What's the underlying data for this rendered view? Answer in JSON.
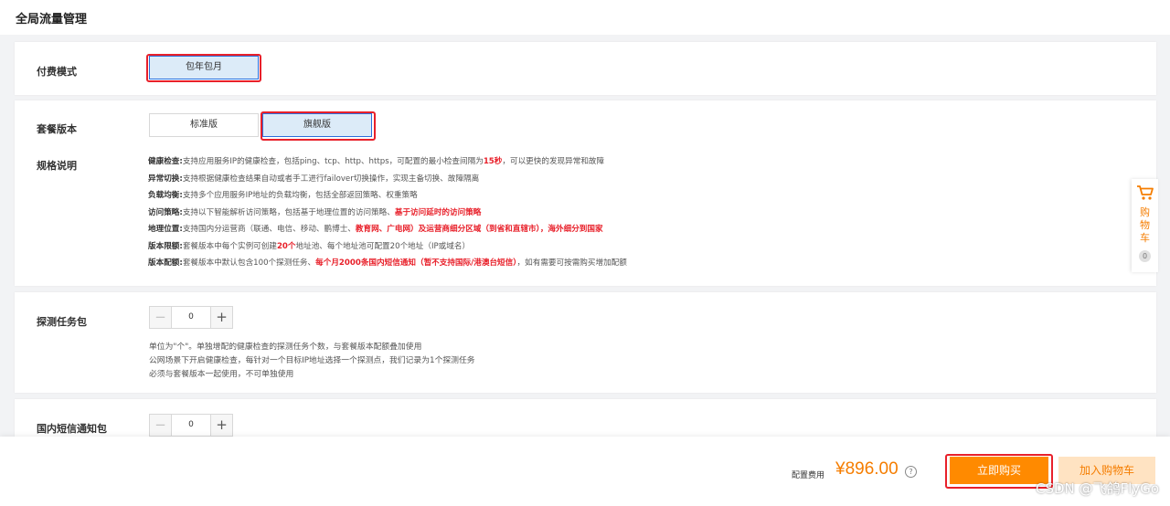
{
  "page": {
    "title": "全局流量管理"
  },
  "billing": {
    "label": "付费模式",
    "option": "包年包月"
  },
  "edition": {
    "label": "套餐版本",
    "options": [
      "标准版",
      "旗舰版"
    ],
    "selected": "旗舰版"
  },
  "spec": {
    "label": "规格说明",
    "lines": [
      {
        "key": "健康检查:",
        "text": "支持应用服务IP的健康检查，包括ping、tcp、http、https，可配置的最小检查间隔为",
        "red": "15秒",
        "tail": "，可以更快的发现异常和故障"
      },
      {
        "key": "异常切换:",
        "text": "支持根据健康检查结果自动或者手工进行failover切换操作，实现主备切换、故障隔离",
        "red": "",
        "tail": ""
      },
      {
        "key": "负载均衡:",
        "text": "支持多个应用服务IP地址的负载均衡，包括全部返回策略、权重策略",
        "red": "",
        "tail": ""
      },
      {
        "key": "访问策略:",
        "text": "支持以下智能解析访问策略，包括基于地理位置的访问策略、",
        "red": "基于访问延时的访问策略",
        "tail": ""
      },
      {
        "key": "地理位置:",
        "text": "支持国内分运营商（联通、电信、移动、鹏博士、",
        "red": "教育网、广电网）及运营商细分区域（到省和直辖市），海外细分到国家",
        "tail": ""
      },
      {
        "key": "版本限额:",
        "text": "套餐版本中每个实例可创建",
        "red": "20个",
        "tail": "地址池、每个地址池可配置20个地址（IP或域名）"
      },
      {
        "key": "版本配额:",
        "text": "套餐版本中默认包含100个探测任务、",
        "red": "每个月2000条国内短信通知（暂不支持国际/港澳台短信）",
        "tail": "，如有需要可按需购买增加配额"
      }
    ]
  },
  "probe": {
    "label": "探测任务包",
    "value": "0",
    "minus": "−",
    "plus": "+",
    "notes": [
      "单位为\"个\"。单独增配的健康检查的探测任务个数，与套餐版本配额叠加使用",
      "公网场景下开启健康检查，每针对一个目标IP地址选择一个探测点，我们记录为1个探测任务",
      "必须与套餐版本一起使用，不可单独使用"
    ]
  },
  "sms": {
    "label": "国内短信通知包",
    "value": "0",
    "minus": "−",
    "plus": "+"
  },
  "footer": {
    "fee_label": "配置费用",
    "fee_value": "¥896.00",
    "help": "?",
    "buy_label": "立即购买",
    "cart_label": "加入购物车"
  },
  "cart_float": {
    "label_chars": [
      "购",
      "物",
      "车"
    ],
    "count": "0"
  },
  "watermark": "CSDN @飞鸽FlyGo",
  "colors": {
    "accent": "#f57d00",
    "highlight": "#e8202a",
    "selected_bg": "#dcebf8"
  }
}
